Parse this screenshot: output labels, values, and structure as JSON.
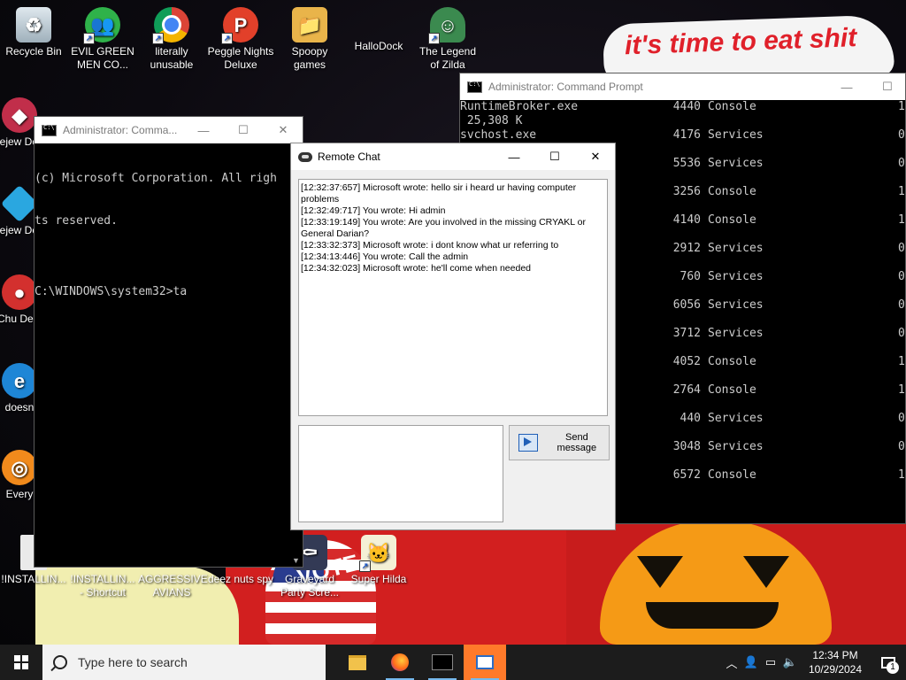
{
  "wallpaper": {
    "banner_text": "it's time to eat shit",
    "flag_text": "VOTE"
  },
  "desktop_icons": [
    {
      "label": "Recycle Bin",
      "icon": "recycle-bin-icon"
    },
    {
      "label": "EVIL GREEN MEN CO...",
      "icon": "green-men-icon"
    },
    {
      "label": "literally unusable",
      "icon": "chrome-icon"
    },
    {
      "label": "Peggle Nights Deluxe",
      "icon": "peggle-icon"
    },
    {
      "label": "Spoopy games",
      "icon": "folder-icon"
    },
    {
      "label": "HalloDock",
      "icon": "windows-logo-icon"
    },
    {
      "label": "The Legend of Zilda",
      "icon": "zilda-icon"
    },
    {
      "label": "Bejew Delu",
      "icon": "bejeweled-icon"
    },
    {
      "label": "Bejew Delu",
      "icon": "bejeweled-diamond-icon"
    },
    {
      "label": "Chu Delu",
      "icon": "chuzzle-icon"
    },
    {
      "label": "doesn",
      "icon": "edge-icon"
    },
    {
      "label": "Every",
      "icon": "everything-icon"
    },
    {
      "label": "!INSTALLIN...",
      "icon": "installer-icon"
    },
    {
      "label": "!INSTALLIN... - Shortcut",
      "icon": "installer-shortcut-icon"
    },
    {
      "label": "AGGRESSIVE AVIANS",
      "icon": "avians-icon"
    },
    {
      "label": "deez nuts spy",
      "icon": "spy-icon"
    },
    {
      "label": "Graveyard Party Scre...",
      "icon": "graveyard-icon"
    },
    {
      "label": "Super Hilda",
      "icon": "hilda-icon"
    }
  ],
  "cmd_small": {
    "title": "Administrator: Comma...",
    "lines": [
      "(c) Microsoft Corporation. All righ",
      "ts reserved.",
      "",
      "C:\\WINDOWS\\system32>ta"
    ]
  },
  "cmd_large": {
    "title": "Administrator: Command Prompt",
    "top_lines": [
      "RuntimeBroker.exe",
      " 25,308 K",
      "svchost.exe"
    ],
    "rows": [
      {
        "pid": "4440",
        "session": "Console",
        "num": "1"
      },
      {
        "pid": "4176",
        "session": "Services",
        "num": "0"
      },
      {
        "pid": "5536",
        "session": "Services",
        "num": "0"
      },
      {
        "pid": "3256",
        "session": "Console",
        "num": "1"
      },
      {
        "pid": "4140",
        "session": "Console",
        "num": "1"
      },
      {
        "pid": "2912",
        "session": "Services",
        "num": "0"
      },
      {
        "pid": "760",
        "session": "Services",
        "num": "0"
      },
      {
        "pid": "6056",
        "session": "Services",
        "num": "0"
      },
      {
        "pid": "3712",
        "session": "Services",
        "num": "0"
      },
      {
        "pid": "4052",
        "session": "Console",
        "num": "1"
      },
      {
        "pid": "2764",
        "session": "Console",
        "num": "1"
      },
      {
        "pid": "440",
        "session": "Services",
        "num": "0"
      },
      {
        "pid": "3048",
        "session": "Services",
        "num": "0"
      },
      {
        "pid": "6572",
        "session": "Console",
        "num": "1"
      }
    ]
  },
  "chat": {
    "title": "Remote Chat",
    "messages": [
      "[12:32:37:657] Microsoft wrote: hello sir i heard ur having computer problems",
      "[12:32:49:717] You wrote: Hi admin",
      "[12:33:19:149] You wrote: Are you involved in the missing CRYAKL or General Darian?",
      "[12:33:32:373] Microsoft wrote: i dont know what ur referring to",
      "[12:34:13:446] You wrote: Call the admin",
      "[12:34:32:023] Microsoft wrote: he'll come when needed"
    ],
    "input_value": "",
    "send_label": "Send message"
  },
  "window_controls": {
    "minimize": "—",
    "maximize": "☐",
    "close": "✕"
  },
  "taskbar": {
    "search_placeholder": "Type here to search",
    "time": "12:34 PM",
    "date": "10/29/2024",
    "notification_count": "1"
  },
  "colors": {
    "taskbar": "#1c1c1c",
    "active_app": "#ff7a2a",
    "console_text": "#cccccc"
  }
}
